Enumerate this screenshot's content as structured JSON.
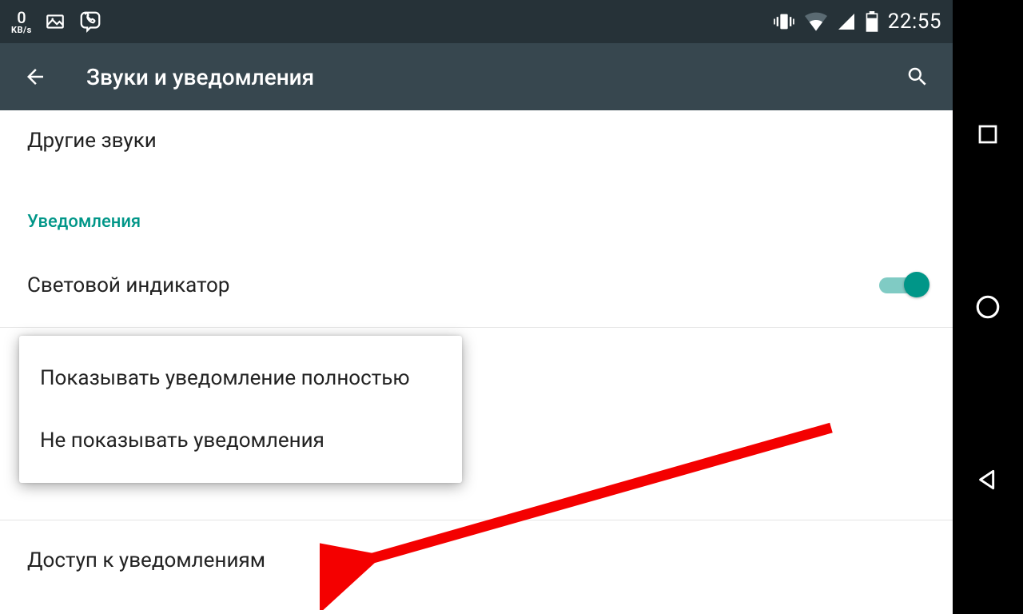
{
  "statusbar": {
    "speed_value": "0",
    "speed_unit": "KB/s",
    "time": "22:55"
  },
  "appbar": {
    "title": "Звуки и уведомления"
  },
  "rows": {
    "other_sounds": "Другие звуки",
    "section_notifications": "Уведомления",
    "led_indicator": "Световой индикатор",
    "notification_access": "Доступ к уведомлениям"
  },
  "popup": {
    "option_full": "Показывать уведомление полностью",
    "option_none": "Не показывать уведомления"
  }
}
